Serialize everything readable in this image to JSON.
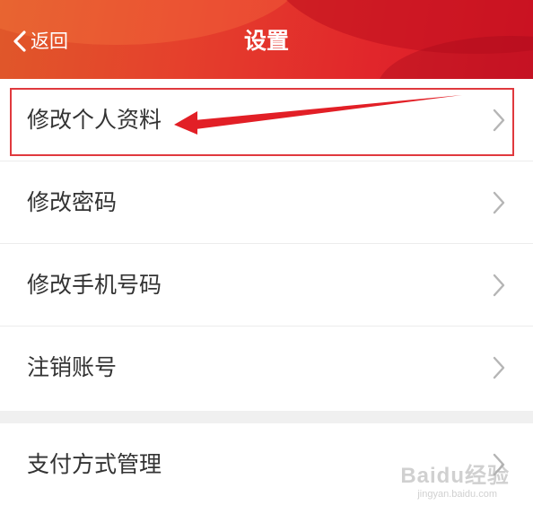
{
  "header": {
    "back_label": "返回",
    "title": "设置"
  },
  "settings": {
    "items": [
      {
        "label": "修改个人资料"
      },
      {
        "label": "修改密码"
      },
      {
        "label": "修改手机号码"
      },
      {
        "label": "注销账号"
      }
    ]
  },
  "payment": {
    "items": [
      {
        "label": "支付方式管理"
      }
    ]
  },
  "watermark": {
    "text": "Baidu经验",
    "sub": "jingyan.baidu.com"
  },
  "colors": {
    "header_start": "#e0582a",
    "header_end": "#d91728",
    "highlight": "#e0393e",
    "text": "#333333",
    "chevron": "#b5b5b5"
  },
  "icons": {
    "back": "chevron-left-icon",
    "row_arrow": "chevron-right-icon"
  }
}
